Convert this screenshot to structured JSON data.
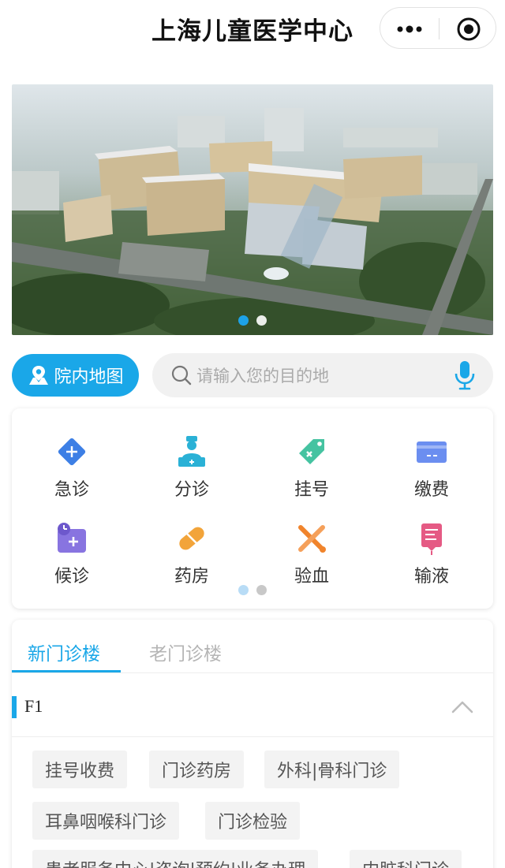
{
  "header": {
    "title": "上海儿童医学中心",
    "more_icon": "more-dots-icon",
    "close_icon": "target-circle-icon"
  },
  "banner": {
    "image": "hospital-aerial-rendering",
    "slide_count": 2,
    "active_slide": 0
  },
  "map_button": {
    "label": "院内地图",
    "icon": "map-location-icon"
  },
  "search": {
    "placeholder": "请输入您的目的地",
    "icon": "search-icon",
    "voice_icon": "microphone-icon"
  },
  "services": [
    {
      "label": "急诊",
      "icon": "emergency-diamond-plus-icon",
      "color": "#3d7fe5"
    },
    {
      "label": "分诊",
      "icon": "nurse-desk-icon",
      "color": "#2ab1d6"
    },
    {
      "label": "挂号",
      "icon": "tag-icon",
      "color": "#45c3a1"
    },
    {
      "label": "缴费",
      "icon": "card-icon",
      "color": "#6b8ef0"
    },
    {
      "label": "候诊",
      "icon": "clock-folder-icon",
      "color": "#8874e0"
    },
    {
      "label": "药房",
      "icon": "pill-icon",
      "color": "#f2a43a"
    },
    {
      "label": "验血",
      "icon": "blood-test-icon",
      "color": "#f0842c"
    },
    {
      "label": "输液",
      "icon": "infusion-bag-icon",
      "color": "#e55a84"
    }
  ],
  "services_pager": {
    "page_count": 2,
    "active_page": 0
  },
  "floor_panel": {
    "tabs": [
      {
        "label": "新门诊楼",
        "active": true
      },
      {
        "label": "老门诊楼",
        "active": false
      }
    ],
    "floor": "F1",
    "accent": "#1aa7e8",
    "departments": [
      "挂号收费",
      "门诊药房",
      "外科|骨科门诊",
      "耳鼻咽喉科门诊",
      "门诊检验",
      "患者服务中心|咨询|预约|业务办理",
      "内脏科门诊"
    ]
  }
}
